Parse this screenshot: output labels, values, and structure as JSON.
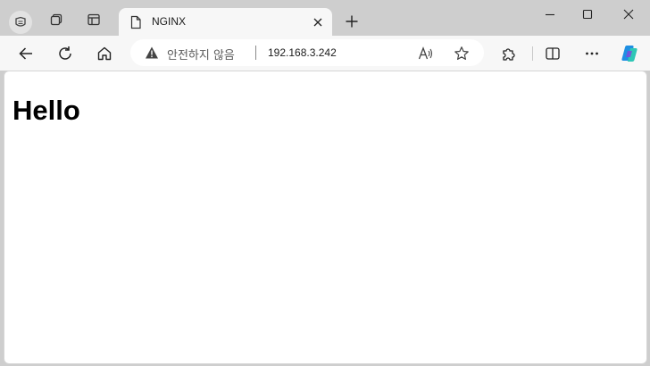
{
  "window": {
    "controls": [
      "minimize-icon",
      "maximize-icon",
      "close-icon"
    ]
  },
  "tabs": [
    {
      "title": "NGINX",
      "icon": "page-icon",
      "active": true
    }
  ],
  "toolbar": {
    "security_text": "안전하지 않음",
    "url": "192.168.3.242"
  },
  "page": {
    "heading": "Hello"
  },
  "colors": {
    "titlebar": "#cecece",
    "toolbar": "#f7f7f7",
    "content_bg": "#ffffff"
  }
}
